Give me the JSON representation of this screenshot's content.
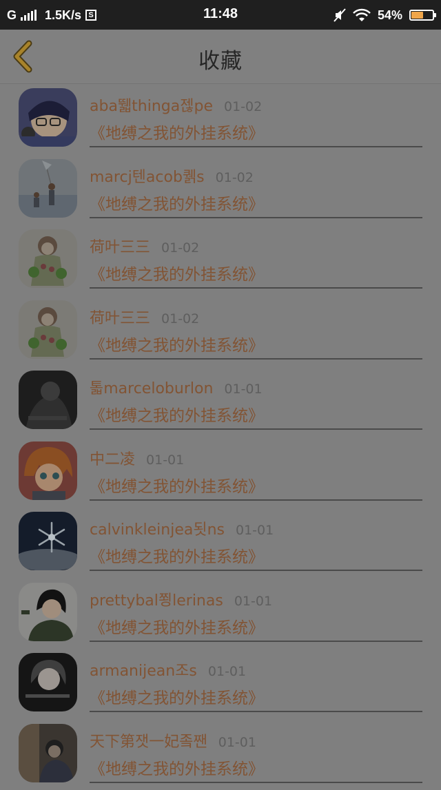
{
  "status_bar": {
    "network": "G",
    "speed": "1.5K/s",
    "sync_icon": "S",
    "time": "11:48",
    "battery_percent": "54%",
    "battery_level": 0.54,
    "battery_color": "#f0a64a"
  },
  "header": {
    "title": "收藏",
    "back_icon": "chevron-left-icon",
    "accent_color": "#b48c28"
  },
  "favorites": [
    {
      "user": "aba뛟thinga젢pe",
      "date": "01-02",
      "book": "《地缚之我的外挂系统》"
    },
    {
      "user": "marcj텐acob퀡s",
      "date": "01-02",
      "book": "《地缚之我的外挂系统》"
    },
    {
      "user": "荷叶三三",
      "date": "01-02",
      "book": "《地缚之我的外挂系统》"
    },
    {
      "user": "荷叶三三",
      "date": "01-02",
      "book": "《地缚之我的外挂系统》"
    },
    {
      "user": "톫marceloburlon",
      "date": "01-01",
      "book": "《地缚之我的外挂系统》"
    },
    {
      "user": "中二凌",
      "date": "01-01",
      "book": "《地缚之我的外挂系统》"
    },
    {
      "user": "calvinkleinjea됫ns",
      "date": "01-01",
      "book": "《地缚之我的外挂系统》"
    },
    {
      "user": "prettybal쬥lerinas",
      "date": "01-01",
      "book": "《地缚之我的外挂系统》"
    },
    {
      "user": "armanijean조s",
      "date": "01-01",
      "book": "《地缚之我的外挂系统》"
    },
    {
      "user": "天下第잿一妃좈짼",
      "date": "01-01",
      "book": "《地缚之我的外挂系统》"
    }
  ],
  "colors": {
    "name_text": "#825434",
    "date_text": "#5e5e5e",
    "overlay_background": "#7f7f7f"
  }
}
